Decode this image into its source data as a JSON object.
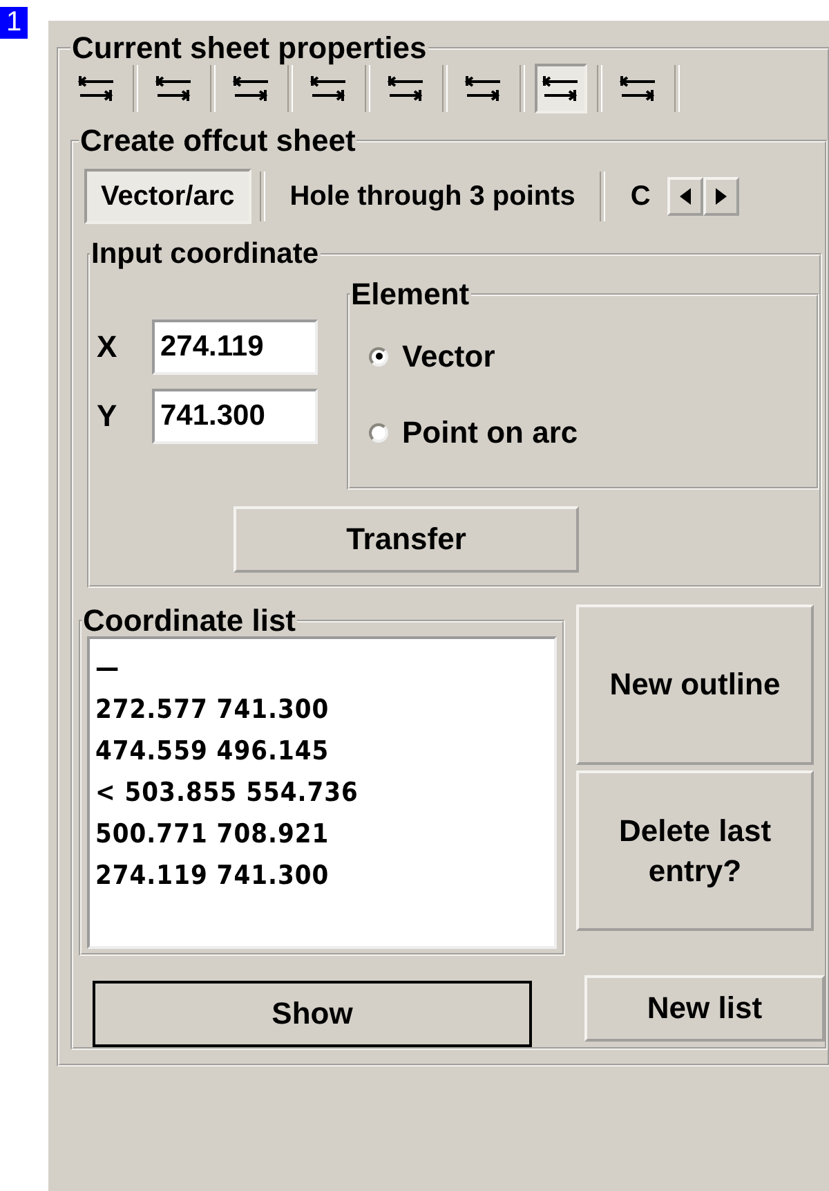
{
  "badge": "1",
  "properties": {
    "title": "Current sheet properties",
    "toolbar": [
      {
        "selected": false
      },
      {
        "selected": false
      },
      {
        "selected": false
      },
      {
        "selected": false
      },
      {
        "selected": false
      },
      {
        "selected": false
      },
      {
        "selected": true
      },
      {
        "selected": false
      }
    ]
  },
  "offcut": {
    "title": "Create offcut sheet",
    "tabs": [
      {
        "label": "Vector/arc",
        "selected": true
      },
      {
        "label": "Hole through 3 points",
        "selected": false
      },
      {
        "label": "C",
        "selected": false
      }
    ],
    "input": {
      "title": "Input coordinate",
      "x_label": "X",
      "x_value": "274.119",
      "y_label": "Y",
      "y_value": "741.300",
      "element": {
        "title": "Element",
        "options": [
          {
            "label": "Vector",
            "selected": true
          },
          {
            "label": "Point on arc",
            "selected": false
          }
        ]
      },
      "transfer": "Transfer"
    },
    "list": {
      "title": "Coordinate list",
      "items": [
        "—",
        "272.577 741.300",
        "474.559 496.145",
        "< 503.855 554.736",
        "500.771 708.921",
        "274.119 741.300"
      ]
    },
    "new_outline": "New outline",
    "delete_last": "Delete last entry?",
    "show": "Show",
    "new_list": "New list"
  }
}
